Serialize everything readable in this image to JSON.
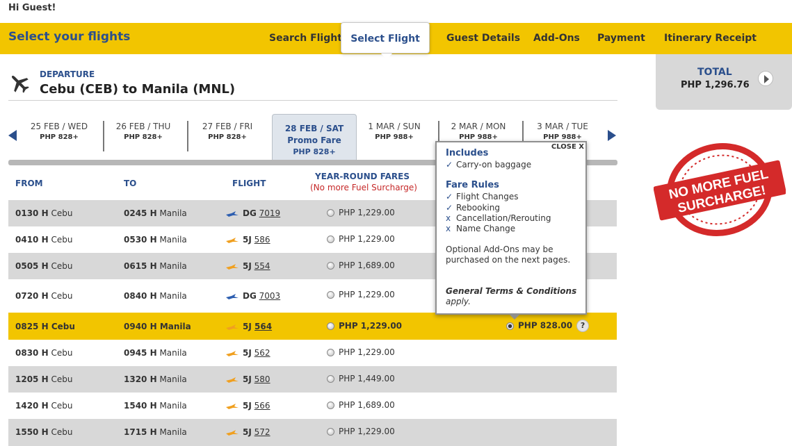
{
  "greeting": "Hi Guest!",
  "header": {
    "title": "Select your flights",
    "nav": [
      {
        "label": "Search Flight",
        "active": false
      },
      {
        "label": "Select Flight",
        "active": true
      },
      {
        "label": "Guest Details",
        "active": false
      },
      {
        "label": "Add-Ons",
        "active": false
      },
      {
        "label": "Payment",
        "active": false
      },
      {
        "label": "Itinerary Receipt",
        "active": false
      }
    ]
  },
  "total": {
    "label": "TOTAL",
    "value": "PHP 1,296.76"
  },
  "departure": {
    "label": "DEPARTURE",
    "route": "Cebu (CEB) to Manila (MNL)"
  },
  "dates": [
    {
      "date": "25 FEB / WED",
      "price": "PHP 828+"
    },
    {
      "date": "26 FEB / THU",
      "price": "PHP 828+"
    },
    {
      "date": "27 FEB / FRI",
      "price": "PHP 828+"
    },
    {
      "date": "28 FEB / SAT",
      "promo": "Promo Fare",
      "price": "PHP 828+"
    },
    {
      "date": "1 MAR / SUN",
      "price": "PHP 988+"
    },
    {
      "date": "2 MAR / MON",
      "price": "PHP 988+"
    },
    {
      "date": "3 MAR / TUE",
      "price": "PHP 988+"
    }
  ],
  "columns": {
    "from": "FROM",
    "to": "TO",
    "flight": "FLIGHT",
    "fares_title": "YEAR-ROUND FARES",
    "fares_note": "(No more Fuel Surcharge)"
  },
  "flights": [
    {
      "dep_time": "0130 H",
      "dep_city": "Cebu",
      "arr_time": "0245 H",
      "arr_city": "Manila",
      "code": "DG",
      "num": "7019",
      "fare": "PHP 1,229.00"
    },
    {
      "dep_time": "0410 H",
      "dep_city": "Cebu",
      "arr_time": "0530 H",
      "arr_city": "Manila",
      "code": "5J",
      "num": "586",
      "fare": "PHP 1,229.00"
    },
    {
      "dep_time": "0505 H",
      "dep_city": "Cebu",
      "arr_time": "0615 H",
      "arr_city": "Manila",
      "code": "5J",
      "num": "554",
      "fare": "PHP 1,689.00"
    },
    {
      "dep_time": "0720 H",
      "dep_city": "Cebu",
      "arr_time": "0840 H",
      "arr_city": "Manila",
      "code": "DG",
      "num": "7003",
      "fare": "PHP 1,229.00"
    },
    {
      "dep_time": "0825 H",
      "dep_city": "Cebu",
      "arr_time": "0940 H",
      "arr_city": "Manila",
      "code": "5J",
      "num": "564",
      "fare": "PHP 1,229.00",
      "promo_fare": "PHP 828.00",
      "help": "?"
    },
    {
      "dep_time": "0830 H",
      "dep_city": "Cebu",
      "arr_time": "0945 H",
      "arr_city": "Manila",
      "code": "5J",
      "num": "562",
      "fare": "PHP 1,229.00"
    },
    {
      "dep_time": "1205 H",
      "dep_city": "Cebu",
      "arr_time": "1320 H",
      "arr_city": "Manila",
      "code": "5J",
      "num": "580",
      "fare": "PHP 1,449.00"
    },
    {
      "dep_time": "1420 H",
      "dep_city": "Cebu",
      "arr_time": "1540 H",
      "arr_city": "Manila",
      "code": "5J",
      "num": "566",
      "fare": "PHP 1,689.00"
    },
    {
      "dep_time": "1550 H",
      "dep_city": "Cebu",
      "arr_time": "1715 H",
      "arr_city": "Manila",
      "code": "5J",
      "num": "572",
      "fare": "PHP 1,229.00"
    }
  ],
  "popup": {
    "close": "CLOSE X",
    "includes_title": "Includes",
    "includes": [
      {
        "mark": "✓",
        "text": "Carry-on baggage"
      }
    ],
    "rules_title": "Fare Rules",
    "rules": [
      {
        "mark": "✓",
        "text": "Flight Changes"
      },
      {
        "mark": "✓",
        "text": "Rebooking"
      },
      {
        "mark": "x",
        "text": "Cancellation/Rerouting"
      },
      {
        "mark": "x",
        "text": "Name Change"
      }
    ],
    "addons_note": "Optional Add-Ons may be purchased on the next pages.",
    "terms_bold": "General Terms & Conditions",
    "terms_rest": "apply."
  },
  "stamp": {
    "line1": "NO MORE FUEL",
    "line2": "SURCHARGE!"
  },
  "colors": {
    "brand_yellow": "#f2c500",
    "brand_blue": "#2b4f8c",
    "stamp_red": "#d42a2a"
  }
}
